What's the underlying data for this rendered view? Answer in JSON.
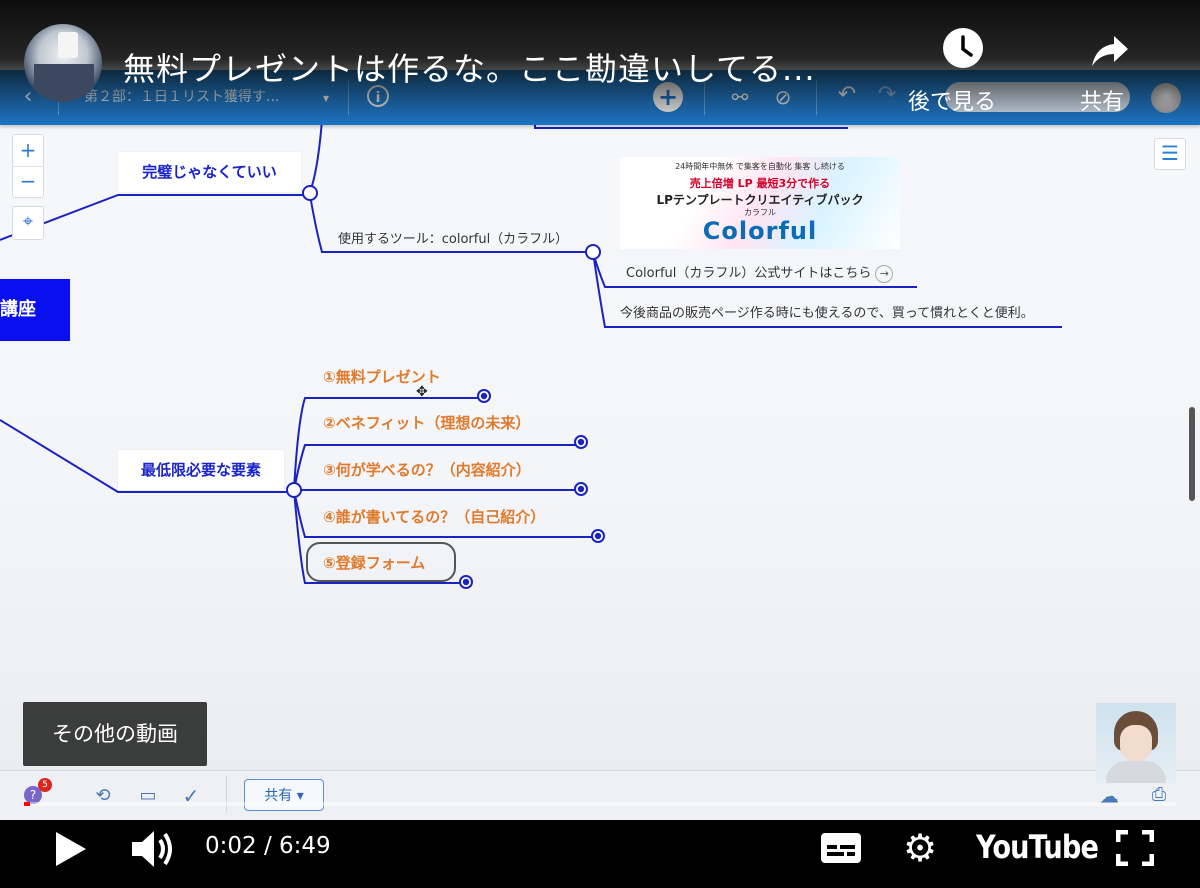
{
  "video": {
    "title": "無料プレゼントは作るな。ここ勘違いしてる...",
    "watch_later_label": "後で見る",
    "share_label": "共有",
    "more_videos_label": "その他の動画",
    "time_current": "0:02",
    "time_total": "6:49",
    "time_display": "0:02 / 6:49",
    "progress_fraction": 0.005,
    "logo_text": "YouTube"
  },
  "app": {
    "doc_title": "第２部：１日１リスト獲得す...",
    "accent": "#1f7ad0",
    "share_button_label": "共有",
    "notification_count": "5"
  },
  "mindmap": {
    "root_label": "講座",
    "node_perfect": "完璧じゃなくていい",
    "tool_label": "使用するツール：colorful（カラフル）",
    "banner": {
      "line1": "24時間年中無休 で集客を自動化 集客 し続ける",
      "line2": "売上倍増 LP 最短3分で作る",
      "line3": "LPテンプレートクリエイティブパック",
      "brand_small": "カラフル",
      "brand": "Colorful"
    },
    "link_text": "Colorful（カラフル）公式サイトはこちら",
    "note_text": "今後商品の販売ページ作る時にも使えるので、買って慣れとくと便利。",
    "node_elements": "最低限必要な要素",
    "items": [
      "①無料プレゼント",
      "②ベネフィット（理想の未来）",
      "③何が学べるの？（内容紹介）",
      "④誰が書いてるの？（自己紹介）",
      "⑤登録フォーム"
    ]
  },
  "colors": {
    "node_text": "#1a24c8",
    "branch_line": "#1a22c0",
    "item_text": "#e07a2c",
    "root_fill": "#0a0ff0",
    "progress": "#ff0000"
  }
}
